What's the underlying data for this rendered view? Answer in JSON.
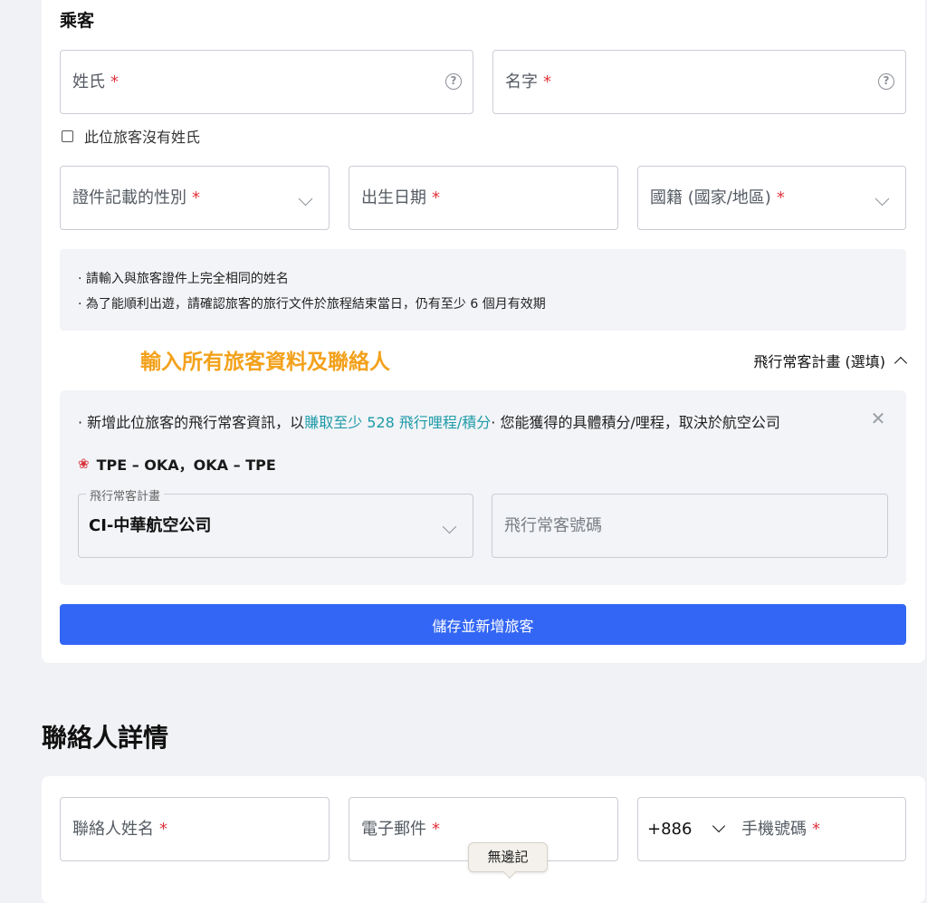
{
  "passenger": {
    "section_title": "乘客",
    "last_name_label": "姓氏",
    "first_name_label": "名字",
    "required_mark": "*",
    "help_symbol": "?",
    "no_surname_label": "此位旅客沒有姓氏",
    "gender_label": "證件記載的性別",
    "dob_label": "出生日期",
    "nationality_label": "國籍 (國家/地區)",
    "notices": [
      "· 請輸入與旅客證件上完全相同的姓名",
      "· 為了能順利出遊，請確認旅客的旅行文件於旅程結束當日，仍有至少 6 個月有效期"
    ]
  },
  "overlay_caption": "輸入所有旅客資料及聯絡人",
  "frequent_flyer": {
    "toggle_label": "飛行常客計畫 (選填)",
    "desc_prefix": "· 新增此位旅客的飛行常客資訊，以",
    "desc_link": "賺取至少 528 飛行哩程/積分",
    "desc_suffix": "· 您能獲得的具體積分/哩程，取決於航空公司",
    "close_symbol": "✕",
    "route": "TPE – OKA，OKA – TPE",
    "airline_icon": "plum-blossom-icon",
    "program_label": "飛行常客計畫",
    "program_value": "CI-中華航空公司",
    "number_placeholder": "飛行常客號碼"
  },
  "save_button_label": "儲存並新增旅客",
  "contact": {
    "title": "聯絡人詳情",
    "name_label": "聯絡人姓名",
    "email_label": "電子郵件",
    "phone_code": "+886",
    "phone_label": "手機號碼"
  },
  "tooltip_text": "無邊記",
  "colors": {
    "accent_blue": "#3366f5",
    "link_teal": "#1e9aa8",
    "required_red": "#e0353d",
    "overlay_orange": "#f3a11b"
  }
}
